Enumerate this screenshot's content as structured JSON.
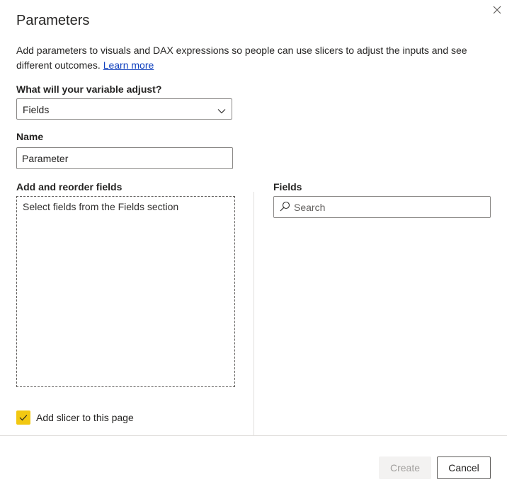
{
  "dialog": {
    "title": "Parameters",
    "description": "Add parameters to visuals and DAX expressions so people can use slicers to adjust the inputs and see different outcomes.",
    "learn_more": "Learn more",
    "close_icon": "close-icon"
  },
  "adjust": {
    "label": "What will your variable adjust?",
    "value": "Fields",
    "icon": "chevron-down-icon"
  },
  "name": {
    "label": "Name",
    "value": "Parameter"
  },
  "reorder": {
    "label": "Add and reorder fields",
    "hint": "Select fields from the Fields section"
  },
  "fields": {
    "label": "Fields",
    "search_placeholder": "Search",
    "icon": "search-icon"
  },
  "slicer": {
    "checked": true,
    "label": "Add slicer to this page",
    "color": "#f2c811"
  },
  "footer": {
    "create_label": "Create",
    "cancel_label": "Cancel"
  }
}
